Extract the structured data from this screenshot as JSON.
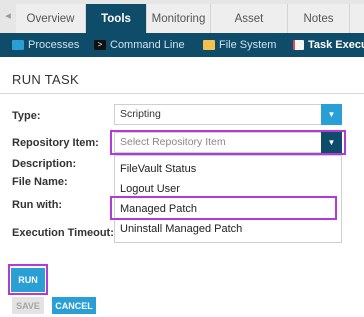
{
  "tabs": {
    "back_arrow": "◂",
    "items": [
      "Overview",
      "Tools",
      "Monitoring",
      "Asset",
      "Notes"
    ],
    "active": "Tools"
  },
  "subnav": {
    "items": [
      {
        "label": "Processes",
        "icon": "processes-icon"
      },
      {
        "label": "Command Line",
        "icon": "terminal-icon"
      },
      {
        "label": "File System",
        "icon": "folder-icon"
      },
      {
        "label": "Task Executio",
        "icon": "task-icon"
      }
    ]
  },
  "main": {
    "title": "RUN TASK",
    "type_label": "Type:",
    "type_value": "Scripting",
    "repo_label": "Repository Item:",
    "repo_placeholder": "Select Repository Item",
    "description_label": "Description:",
    "filename_label": "File Name:",
    "runwith_label": "Run with:",
    "timeout_label": "Execution Timeout:",
    "dropdown_options": [
      "FileVault Status",
      "Logout User",
      "Managed Patch",
      "Uninstall Managed Patch"
    ],
    "highlighted_option": "Managed Patch"
  },
  "buttons": {
    "run": "RUN",
    "save": "SAVE",
    "cancel": "CANCEL"
  },
  "colors": {
    "dark_blue": "#0f4c6a",
    "accent_blue": "#2a9fd6",
    "highlight_purple": "#b23ad8"
  }
}
